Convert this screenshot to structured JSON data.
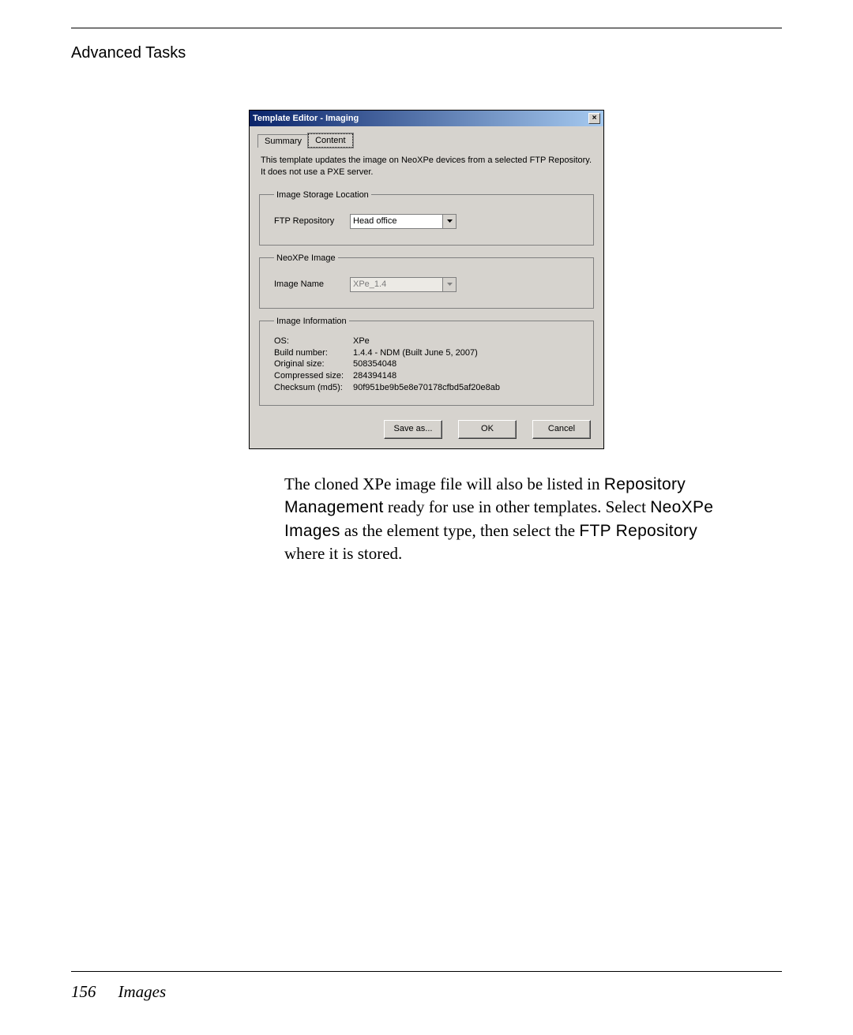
{
  "header": "Advanced Tasks",
  "dialog": {
    "title": "Template Editor - Imaging",
    "tabs": {
      "summary": "Summary",
      "content": "Content"
    },
    "description": "This template updates the image on NeoXPe devices from a selected FTP Repository. It does not use a PXE server.",
    "groups": {
      "storage": {
        "legend": "Image Storage Location",
        "ftp_label": "FTP Repository",
        "ftp_value": "Head office"
      },
      "image": {
        "legend": "NeoXPe Image",
        "name_label": "Image Name",
        "name_value": "XPe_1.4"
      },
      "info": {
        "legend": "Image Information",
        "rows": {
          "os_k": "OS:",
          "os_v": "XPe",
          "build_k": "Build number:",
          "build_v": "1.4.4 - NDM (Built June 5, 2007)",
          "orig_k": "Original size:",
          "orig_v": "508354048",
          "comp_k": "Compressed size:",
          "comp_v": "284394148",
          "md5_k": "Checksum (md5):",
          "md5_v": "90f951be9b5e8e70178cfbd5af20e8ab"
        }
      }
    },
    "buttons": {
      "saveas": "Save as...",
      "ok": "OK",
      "cancel": "Cancel"
    }
  },
  "paragraph": {
    "t1": "The cloned XPe image file will also be listed in ",
    "s1": "Repository Management",
    "t2": " ready for use in other templates. Select ",
    "s2": "NeoXPe Images",
    "t3": " as the element type, then select the ",
    "s3": "FTP Repository",
    "t4": " where it is stored."
  },
  "footer": {
    "page": "156",
    "section": "Images"
  }
}
